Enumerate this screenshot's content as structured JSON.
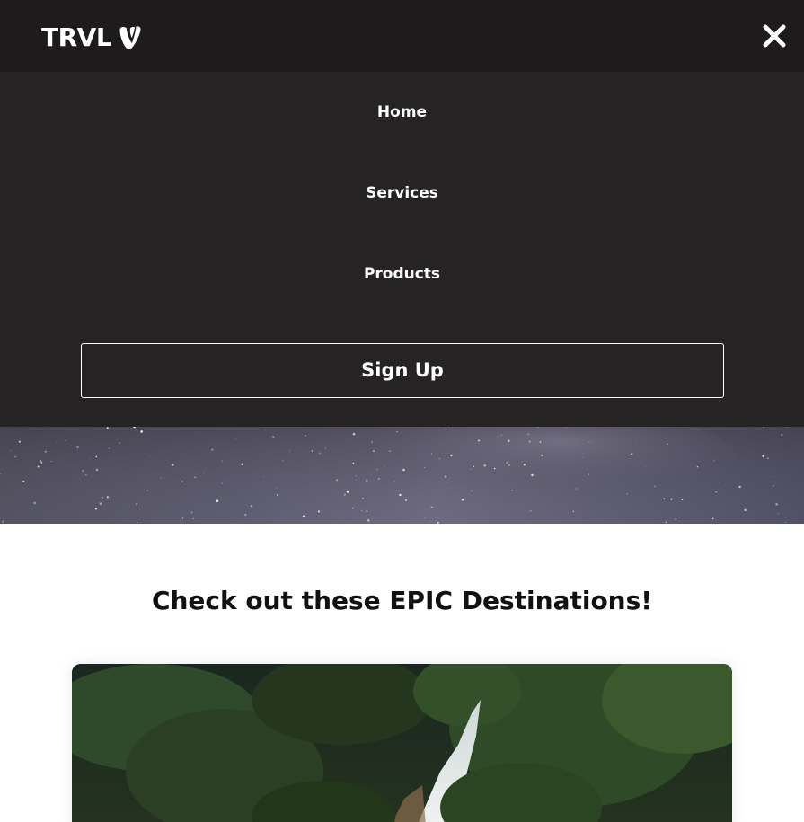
{
  "header": {
    "logo_text": "TRVL",
    "logo_icon": "typo3-icon",
    "close_icon": "close-icon"
  },
  "menu": {
    "items": [
      {
        "label": "Home"
      },
      {
        "label": "Services"
      },
      {
        "label": "Products"
      }
    ],
    "signup_label": "Sign Up"
  },
  "content": {
    "title": "Check out these EPIC Destinations!"
  },
  "colors": {
    "header_bg": "#1e1b1c",
    "menu_bg": "#262324",
    "text_light": "#ffffff",
    "title_text": "#111111"
  }
}
